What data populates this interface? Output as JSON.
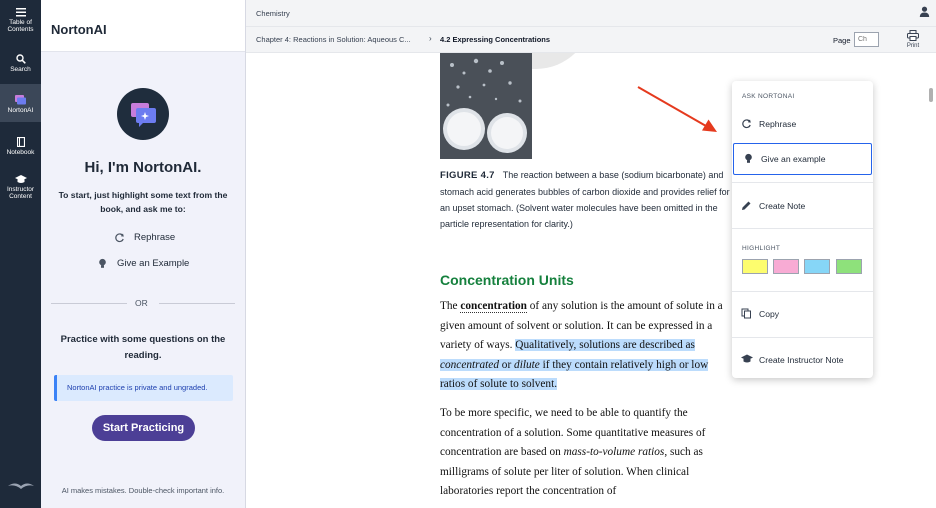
{
  "rail": {
    "items": [
      {
        "label1": "Table of",
        "label2": "Contents"
      },
      {
        "label1": "Search",
        "label2": ""
      },
      {
        "label1": "NortonAI",
        "label2": ""
      },
      {
        "label1": "Notebook",
        "label2": ""
      },
      {
        "label1": "Instructor",
        "label2": "Content"
      }
    ]
  },
  "panel": {
    "title": "NortonAI",
    "greeting": "Hi, I'm NortonAI.",
    "intro": "To start, just highlight some text from the book, and ask me to:",
    "option1": "Rephrase",
    "option2": "Give an Example",
    "or": "OR",
    "practice": "Practice with some questions on the reading.",
    "notice": "NortonAI practice is private and ungraded.",
    "start_button": "Start Practicing",
    "disclaimer": "AI makes mistakes. Double-check important info."
  },
  "header": {
    "book_title": "Chemistry",
    "breadcrumb_chapter": "Chapter 4: Reactions in Solution: Aqueous C...",
    "breadcrumb_separator": "›",
    "breadcrumb_section": "4.2 Expressing Concentrations",
    "page_label": "Page",
    "page_placeholder": "Ch",
    "print_label": "Print"
  },
  "content": {
    "figure_label": "FIGURE 4.7",
    "figure_caption": "The reaction between a base (sodium bicarbonate) and stomach acid generates bubbles of carbon dioxide and provides relief for an upset stomach. (Solvent water molecules have been omitted in the particle representation for clarity.)",
    "section_title": "Concentration Units",
    "p1_a": "The ",
    "p1_term": "concentration",
    "p1_b": " of any solution is the amount of solute in a given amount of solvent or solution. It can be expressed in a variety of ways. ",
    "p1_hl_a": "Qualitatively, solutions are described as ",
    "p1_hl_em1": "concentrated",
    "p1_hl_b": " or ",
    "p1_hl_em2": "dilute",
    "p1_hl_c": " if they contain relatively high or low ratios of solute to solvent.",
    "p2_a": "To be more specific, we need to be able to quantify the concentration of a solution. Some quantitative measures of concentration are based on ",
    "p2_em1": "mass-to-volume ratios",
    "p2_b": ", such as milligrams of solute per liter of solution. When clinical laboratories report the concentration of"
  },
  "menu": {
    "ask_label": "ASK NORTONAI",
    "rephrase": "Rephrase",
    "give_example": "Give an example",
    "create_note": "Create Note",
    "highlight_label": "HIGHLIGHT",
    "copy": "Copy",
    "instructor_note": "Create Instructor Note",
    "swatches": [
      "#fdfd6e",
      "#f8abd4",
      "#86d6f7",
      "#8ee17b"
    ]
  },
  "colors": {
    "rail_bg": "#1e2a3a",
    "accent_button": "#4c3f96",
    "section_title": "#15803d",
    "highlight": "#bcdcfc",
    "arrow": "#e53a1e"
  }
}
